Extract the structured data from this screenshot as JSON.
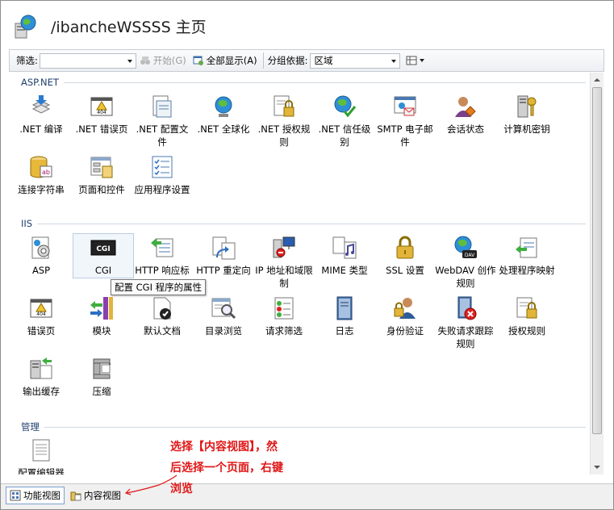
{
  "header": {
    "title": "/ibancheWSSSS 主页"
  },
  "toolbar": {
    "filter_label": "筛选:",
    "filter_value": "",
    "start_label": "开始(G)",
    "showall_label": "全部显示(A)",
    "groupby_label": "分组依据:",
    "groupby_value": "区域"
  },
  "groups": {
    "aspnet": "ASP.NET",
    "iis": "IIS",
    "manage": "管理"
  },
  "features": {
    "net_compile": ".NET 编译",
    "net_error": ".NET 错误页",
    "net_config": ".NET 配置文件",
    "net_global": ".NET 全球化",
    "net_authz": ".NET 授权规则",
    "net_trust": ".NET 信任级别",
    "smtp": "SMTP 电子邮件",
    "session": "会话状态",
    "machinekey": "计算机密钥",
    "connstr": "连接字符串",
    "pages": "页面和控件",
    "appsettings": "应用程序设置",
    "asp": "ASP",
    "cgi": "CGI",
    "http_resp": "HTTP 响应标",
    "http_redir": "HTTP 重定向",
    "ip_domain": "IP 地址和域限制",
    "mime": "MIME 类型",
    "ssl": "SSL 设置",
    "webdav": "WebDAV 创作规则",
    "handlers": "处理程序映射",
    "errorpages": "错误页",
    "modules": "模块",
    "defaultdoc": "默认文档",
    "dirbrowse": "目录浏览",
    "reqfilter": "请求筛选",
    "logging": "日志",
    "auth": "身份验证",
    "failedreq": "失败请求跟踪规则",
    "authzrules": "授权规则",
    "outputcache": "输出缓存",
    "compression": "压缩",
    "configeditor": "配置编辑器"
  },
  "tooltip": "配置 CGI 程序的属性",
  "bottombar": {
    "features_view": "功能视图",
    "content_view": "内容视图"
  },
  "annotation": {
    "line1": "选择【内容视图】，然",
    "line2": "后选择一个页面，右键",
    "line3": "浏览"
  },
  "colors": {
    "annotation": "#e01616",
    "group_header": "#1f3f6e",
    "selection": "#b9cde6"
  }
}
